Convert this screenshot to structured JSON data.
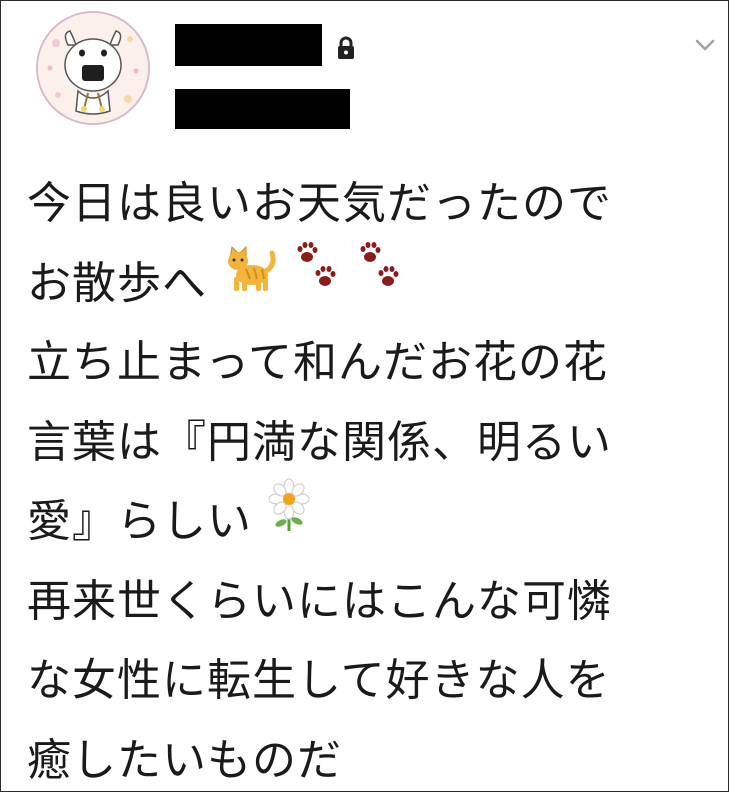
{
  "account": {
    "avatar_icon": "cow-onigiri-avatar-icon",
    "name": "",
    "handle": "",
    "protected_icon": "lock-icon",
    "menu_icon": "chevron-down-icon"
  },
  "tweet": {
    "lines": [
      {
        "text": "今日は良いお天気だったので",
        "emoji": []
      },
      {
        "text": "お散歩へ",
        "emoji": [
          "cat-emoji-icon",
          "paw-prints-icon",
          "paw-prints-icon"
        ]
      },
      {
        "text": "立ち止まって和んだお花の花",
        "emoji": []
      },
      {
        "text": "言葉は『円満な関係、明るい",
        "emoji": []
      },
      {
        "text": "愛』らしい",
        "emoji": [
          "daisy-flower-icon"
        ]
      },
      {
        "text": "再来世くらいにはこんな可憐",
        "emoji": []
      },
      {
        "text": "な女性に転生して好きな人を",
        "emoji": []
      },
      {
        "text": "癒したいものだ",
        "emoji": []
      }
    ]
  },
  "colors": {
    "text": "#1a1a1a",
    "redaction": "#000000",
    "border": "#2b2b2b",
    "paw": "#8b1c1c",
    "cat": "#f2b43a",
    "avatar_ring": "#d9b8c8"
  }
}
